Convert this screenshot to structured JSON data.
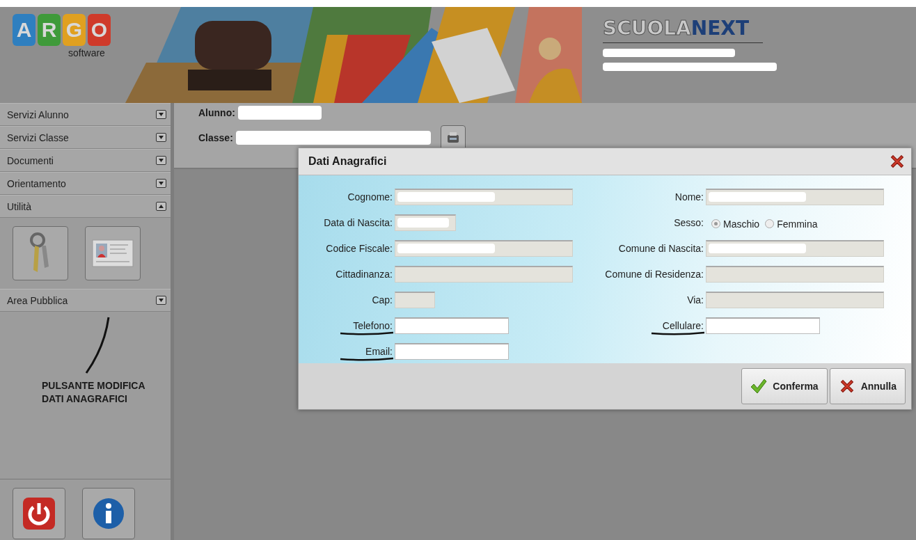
{
  "header": {
    "logo_letters": [
      {
        "letter": "A",
        "color": "#2f7fbf"
      },
      {
        "letter": "R",
        "color": "#3f9a3a"
      },
      {
        "letter": "G",
        "color": "#e0a020"
      },
      {
        "letter": "O",
        "color": "#cf3a2a"
      }
    ],
    "logo_caption": "software",
    "brand": [
      {
        "text": "SCUOLA",
        "kind": "light"
      },
      {
        "text": "NEXT",
        "kind": "strong"
      }
    ],
    "school_lines": [
      {
        "redacted": true
      },
      {
        "redacted": true
      }
    ]
  },
  "sidebar": {
    "sections": [
      {
        "label": "Servizi Alunno",
        "expanded": false
      },
      {
        "label": "Servizi Classe",
        "expanded": false
      },
      {
        "label": "Documenti",
        "expanded": false
      },
      {
        "label": "Orientamento",
        "expanded": false
      },
      {
        "label": "Utilità",
        "expanded": true
      },
      {
        "label": "Area Pubblica",
        "expanded": false
      }
    ]
  },
  "annotation": {
    "text": "PULSANTE MODIFICA\nDATI ANAGRAFICI"
  },
  "student": {
    "fields": [
      {
        "label": "Alunno:",
        "redacted": true
      },
      {
        "label": "Classe:",
        "redacted": true
      }
    ]
  },
  "dialog": {
    "title": "Dati Anagrafici",
    "rows": [
      {
        "left": {
          "label": "Cognome:",
          "kind": "text",
          "editable": false,
          "redacted": true
        },
        "right": {
          "label": "Nome:",
          "kind": "text",
          "editable": false,
          "redacted": true
        }
      },
      {
        "left": {
          "label": "Data di Nascita:",
          "kind": "text",
          "editable": false,
          "redacted": true
        },
        "right": {
          "label": "Sesso:",
          "kind": "radio",
          "options": [
            {
              "label": "Maschio",
              "selected": true
            },
            {
              "label": "Femmina",
              "selected": false
            }
          ]
        }
      },
      {
        "left": {
          "label": "Codice Fiscale:",
          "kind": "text",
          "editable": false,
          "redacted": true
        },
        "right": {
          "label": "Comune di Nascita:",
          "kind": "text",
          "editable": false,
          "redacted": true
        }
      },
      {
        "left": {
          "label": "Cittadinanza:",
          "kind": "text",
          "editable": false
        },
        "right": {
          "label": "Comune di Residenza:",
          "kind": "text",
          "editable": false
        }
      },
      {
        "left": {
          "label": "Cap:",
          "kind": "text",
          "editable": false
        },
        "right": {
          "label": "Via:",
          "kind": "text",
          "editable": false
        }
      },
      {
        "left": {
          "label": "Telefono:",
          "kind": "text",
          "editable": true,
          "underlined": true
        },
        "right": {
          "label": "Cellulare:",
          "kind": "text",
          "editable": true,
          "underlined": true
        }
      },
      {
        "left": {
          "label": "Email:",
          "kind": "text",
          "editable": true,
          "underlined": true
        }
      }
    ],
    "buttons": [
      {
        "label": "Conferma",
        "kind": "confirm"
      },
      {
        "label": "Annulla",
        "kind": "cancel"
      }
    ]
  }
}
